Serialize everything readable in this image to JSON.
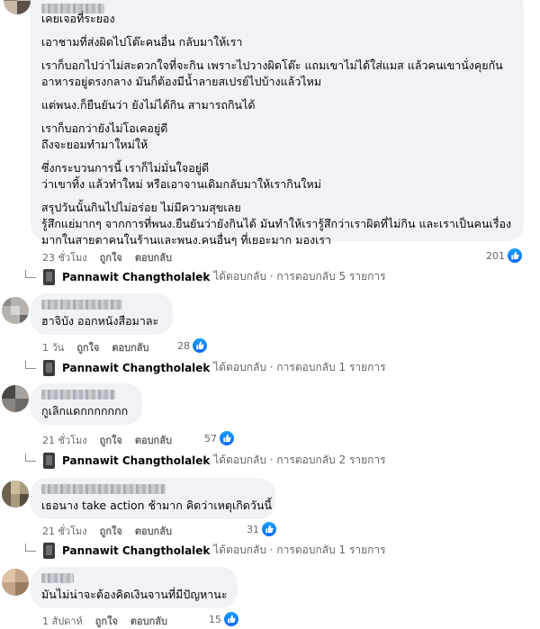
{
  "comments": [
    {
      "lines": [
        "เคยเจอที่ระยอง",
        "เอาชามที่ส่งผิดไปโต๊ะคนอื่น กลับมาให้เรา",
        "เราก็บอกไปว่าไม่สะดวกใจที่จะกิน เพราะไปวางผิดโต๊ะ แถมเขาไม่ได้ใส่แมส แล้วคนเขานั่งคุยกัน",
        "อาหารอยู่ตรงกลาง มันก็ต้องมีน้ำลายสเปรย์ไปบ้างแล้วไหม",
        "แต่พนง.ก็ยืนยันว่า ยังไม่ได้กิน สามารถกินได้",
        "เราก็บอกว่ายังไม่โอเคอยู่ดี",
        "ถึงจะยอมทำมาใหม่ให้",
        "ซึ่งกระบวนการนี้ เราก็ไม่มั่นใจอยู่ดี",
        "ว่าเขาทิ้ง แล้วทำใหม่ หรือเอาจานเดิมกลับมาให้เรากินใหม่",
        "สรุปวันนั้นกินไปไม่อร่อย ไม่มีความสุขเลย",
        "รู้สึกแย่มากๆ จากการที่พนง.ยืนยันว่ายังกินได้ มันทำให้เรารู้สึกว่าเราผิดที่ไม่กิน และเราเป็นคนเรื่อง",
        "มากในสายตาคนในร้านและพนง.คนอื่นๆ ที่เยอะมาก มองเรา"
      ],
      "time": "23 ชั่วโมง",
      "like_label": "ถูกใจ",
      "reply_label": "ตอบกลับ",
      "reaction_count": "201",
      "reply_author": "Pannawit Changtholalek",
      "reply_summary": "ได้ตอบกลับ · การตอบกลับ 5 รายการ"
    },
    {
      "lines": [
        "ฮาจิบัง ออกหนังสือมาละ"
      ],
      "time": "1 วัน",
      "like_label": "ถูกใจ",
      "reply_label": "ตอบกลับ",
      "reaction_count": "28",
      "reply_author": "Pannawit Changtholalek",
      "reply_summary": "ได้ตอบกลับ · การตอบกลับ 1 รายการ"
    },
    {
      "lines": [
        "กูเลิกแดกกกกกกก"
      ],
      "time": "21 ชั่วโมง",
      "like_label": "ถูกใจ",
      "reply_label": "ตอบกลับ",
      "reaction_count": "57",
      "reply_author": "Pannawit Changtholalek",
      "reply_summary": "ได้ตอบกลับ · การตอบกลับ 2 รายการ"
    },
    {
      "lines": [
        "เธอนาง take action ช้ามาก คิดว่าเหตุเกิดวันนี้"
      ],
      "time": "21 ชั่วโมง",
      "like_label": "ถูกใจ",
      "reply_label": "ตอบกลับ",
      "reaction_count": "31",
      "reply_author": "Pannawit Changtholalek",
      "reply_summary": "ได้ตอบกลับ · การตอบกลับ 1 รายการ"
    },
    {
      "lines": [
        "มันไม่น่าจะต้องคิดเงินจานที่มีปัญหานะ"
      ],
      "time": "1 สัปดาห์",
      "like_label": "ถูกใจ",
      "reply_label": "ตอบกลับ",
      "reaction_count": "15"
    }
  ],
  "colors": {
    "bubble": "#f0f2f5",
    "like_blue": "#0866ff",
    "meta": "#65676b"
  },
  "icons": [
    "avatar",
    "like-icon",
    "reply-arrow-icon",
    "reply-avatar"
  ]
}
